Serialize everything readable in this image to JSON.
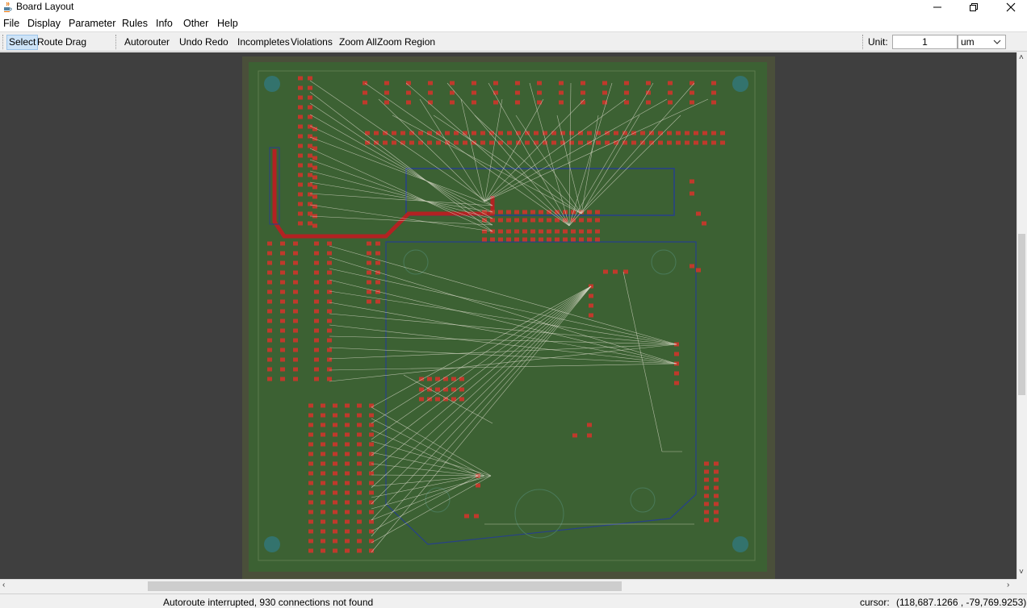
{
  "window": {
    "title": "Board Layout"
  },
  "menu": [
    "File",
    "Display",
    "Parameter",
    "Rules",
    "Info",
    "Other",
    "Help"
  ],
  "toolbar": {
    "select": "Select",
    "route": "Route",
    "drag": "Drag",
    "autorouter": "Autorouter",
    "undo": "Undo",
    "redo": "Redo",
    "incompletes": "Incompletes",
    "violations": "Violations",
    "zoom_all": "Zoom All",
    "zoom_region": "Zoom Region",
    "unit_label": "Unit:",
    "unit_value": "1",
    "unit_option": "um"
  },
  "status": {
    "message": "Autoroute interrupted, 930 connections not found",
    "cursor_label": "cursor:",
    "cursor_value": "(118,687.1266 , -79,769.9253)"
  },
  "icons": {
    "app": "java-coffee-cup-icon",
    "minimize": "minimize-icon",
    "restore": "restore-icon",
    "close": "close-icon",
    "dropdown": "chevron-down-icon",
    "scroll_up": "arrow-up-icon",
    "scroll_down": "arrow-down-icon",
    "scroll_left": "arrow-left-icon",
    "scroll_right": "arrow-right-icon"
  },
  "colors": {
    "canvas_bg": "#3f3f3f",
    "board_edge": "#4a4f3a",
    "board": "#3c6133",
    "pad": "#c0392b",
    "pad_hole": "#d35400",
    "trace": "#b22222",
    "airwire": "#d9d9c8",
    "outline_blue": "#1e3a8a",
    "via_teal": "#1f8a9a"
  }
}
